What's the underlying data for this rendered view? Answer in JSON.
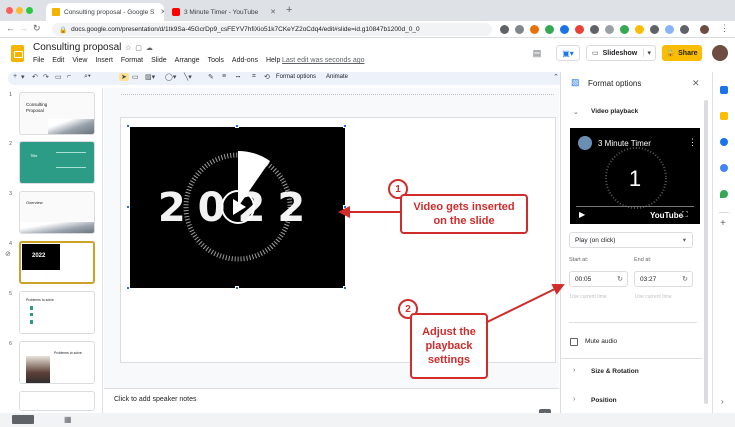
{
  "browser": {
    "tabs": [
      {
        "title": "Consulting proposal - Google S",
        "icon": "slides-favicon"
      },
      {
        "title": "3 Minute Timer - YouTube",
        "icon": "youtube-favicon"
      }
    ],
    "url": "docs.google.com/presentation/d/1tk9Sa-45GcrDp9_csFEYV7hfiXio51k7CKeYZ2oCdq4/edit#slide=id.g10847b1200d_0_0"
  },
  "docs": {
    "title": "Consulting proposal",
    "menu": [
      "File",
      "Edit",
      "View",
      "Insert",
      "Format",
      "Slide",
      "Arrange",
      "Tools",
      "Add-ons",
      "Help"
    ],
    "last_edit": "Last edit was seconds ago",
    "slideshow_label": "Slideshow",
    "share_label": "Share"
  },
  "toolbar": {
    "format_options": "Format options",
    "animate": "Animate"
  },
  "filmstrip": {
    "slides": [
      {
        "number": "1",
        "title": "Consulting Proposal"
      },
      {
        "number": "2",
        "title": "Title"
      },
      {
        "number": "3",
        "title": "Overview"
      },
      {
        "number": "4",
        "title": "2022"
      },
      {
        "number": "5",
        "title": "Problems to solve"
      },
      {
        "number": "6",
        "title": "Problems to solve"
      }
    ]
  },
  "canvas": {
    "video_text": "2022",
    "notes_placeholder": "Click to add speaker notes"
  },
  "panel": {
    "title": "Format options",
    "video_section": "Video playback",
    "yt_title": "3 Minute Timer",
    "yt_counter": "1",
    "yt_brand": "YouTube",
    "play_mode": "Play (on click)",
    "start_label": "Start at:",
    "start_value": "00:05",
    "end_label": "End at:",
    "end_value": "03:27",
    "use_current_time": "Use current time",
    "mute_label": "Mute audio",
    "size_section": "Size & Rotation",
    "position_section": "Position"
  },
  "annotations": {
    "step1_number": "1",
    "step1_line1": "Video gets inserted",
    "step1_line2": "on the slide",
    "step2_number": "2",
    "step2_line1": "Adjust the",
    "step2_line2": "playback",
    "step2_line3": "settings"
  },
  "colors": {
    "accent_red": "#d02c2c",
    "share_yellow": "#fbbc04",
    "selection_blue": "#1a73e8"
  }
}
